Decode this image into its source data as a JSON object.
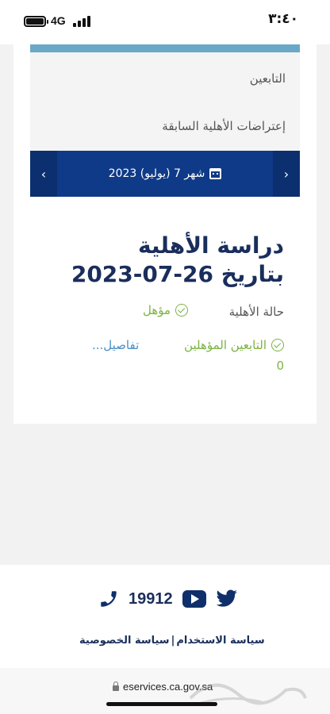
{
  "status_bar": {
    "time": "٣:٤٠",
    "network": "4G"
  },
  "nav": {
    "dependents": "التابعين",
    "previous_objections": "إعتراضات الأهلية السابقة"
  },
  "month_selector": {
    "label": "شهر 7 (يوليو) 2023",
    "prev_icon": "chevron-left-icon",
    "next_icon": "chevron-right-icon"
  },
  "eligibility": {
    "title_line1": "دراسة الأهلية",
    "title_line2": "بتاريخ 26-07-2023",
    "status_label": "حالة الأهلية",
    "status_value": "مؤهل",
    "eligible_dependents_label": "التابعين المؤهلين",
    "details_link": "تفاصيل...",
    "eligible_dependents_count": "0"
  },
  "footer": {
    "phone": "19912",
    "terms_link": "سياسة الاستخدام",
    "separator": "|",
    "privacy_link": "سياسة الخصوصية"
  },
  "browser": {
    "url": "eservices.ca.gov.sa"
  },
  "colors": {
    "navy": "#0f3a87",
    "title": "#1a2e5c",
    "green": "#7cb342",
    "link_blue": "#4a8fc4",
    "accent_strip": "#6aa8c8"
  }
}
